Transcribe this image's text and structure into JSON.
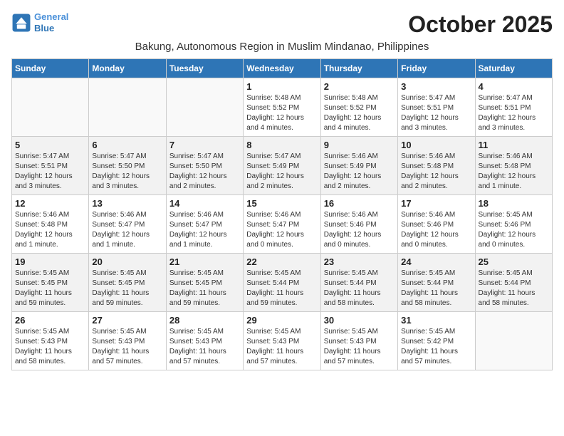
{
  "logo": {
    "line1": "General",
    "line2": "Blue"
  },
  "title": "October 2025",
  "subtitle": "Bakung, Autonomous Region in Muslim Mindanao, Philippines",
  "days_of_week": [
    "Sunday",
    "Monday",
    "Tuesday",
    "Wednesday",
    "Thursday",
    "Friday",
    "Saturday"
  ],
  "weeks": [
    [
      {
        "day": "",
        "info": ""
      },
      {
        "day": "",
        "info": ""
      },
      {
        "day": "",
        "info": ""
      },
      {
        "day": "1",
        "info": "Sunrise: 5:48 AM\nSunset: 5:52 PM\nDaylight: 12 hours\nand 4 minutes."
      },
      {
        "day": "2",
        "info": "Sunrise: 5:48 AM\nSunset: 5:52 PM\nDaylight: 12 hours\nand 4 minutes."
      },
      {
        "day": "3",
        "info": "Sunrise: 5:47 AM\nSunset: 5:51 PM\nDaylight: 12 hours\nand 3 minutes."
      },
      {
        "day": "4",
        "info": "Sunrise: 5:47 AM\nSunset: 5:51 PM\nDaylight: 12 hours\nand 3 minutes."
      }
    ],
    [
      {
        "day": "5",
        "info": "Sunrise: 5:47 AM\nSunset: 5:51 PM\nDaylight: 12 hours\nand 3 minutes."
      },
      {
        "day": "6",
        "info": "Sunrise: 5:47 AM\nSunset: 5:50 PM\nDaylight: 12 hours\nand 3 minutes."
      },
      {
        "day": "7",
        "info": "Sunrise: 5:47 AM\nSunset: 5:50 PM\nDaylight: 12 hours\nand 2 minutes."
      },
      {
        "day": "8",
        "info": "Sunrise: 5:47 AM\nSunset: 5:49 PM\nDaylight: 12 hours\nand 2 minutes."
      },
      {
        "day": "9",
        "info": "Sunrise: 5:46 AM\nSunset: 5:49 PM\nDaylight: 12 hours\nand 2 minutes."
      },
      {
        "day": "10",
        "info": "Sunrise: 5:46 AM\nSunset: 5:48 PM\nDaylight: 12 hours\nand 2 minutes."
      },
      {
        "day": "11",
        "info": "Sunrise: 5:46 AM\nSunset: 5:48 PM\nDaylight: 12 hours\nand 1 minute."
      }
    ],
    [
      {
        "day": "12",
        "info": "Sunrise: 5:46 AM\nSunset: 5:48 PM\nDaylight: 12 hours\nand 1 minute."
      },
      {
        "day": "13",
        "info": "Sunrise: 5:46 AM\nSunset: 5:47 PM\nDaylight: 12 hours\nand 1 minute."
      },
      {
        "day": "14",
        "info": "Sunrise: 5:46 AM\nSunset: 5:47 PM\nDaylight: 12 hours\nand 1 minute."
      },
      {
        "day": "15",
        "info": "Sunrise: 5:46 AM\nSunset: 5:47 PM\nDaylight: 12 hours\nand 0 minutes."
      },
      {
        "day": "16",
        "info": "Sunrise: 5:46 AM\nSunset: 5:46 PM\nDaylight: 12 hours\nand 0 minutes."
      },
      {
        "day": "17",
        "info": "Sunrise: 5:46 AM\nSunset: 5:46 PM\nDaylight: 12 hours\nand 0 minutes."
      },
      {
        "day": "18",
        "info": "Sunrise: 5:45 AM\nSunset: 5:46 PM\nDaylight: 12 hours\nand 0 minutes."
      }
    ],
    [
      {
        "day": "19",
        "info": "Sunrise: 5:45 AM\nSunset: 5:45 PM\nDaylight: 11 hours\nand 59 minutes."
      },
      {
        "day": "20",
        "info": "Sunrise: 5:45 AM\nSunset: 5:45 PM\nDaylight: 11 hours\nand 59 minutes."
      },
      {
        "day": "21",
        "info": "Sunrise: 5:45 AM\nSunset: 5:45 PM\nDaylight: 11 hours\nand 59 minutes."
      },
      {
        "day": "22",
        "info": "Sunrise: 5:45 AM\nSunset: 5:44 PM\nDaylight: 11 hours\nand 59 minutes."
      },
      {
        "day": "23",
        "info": "Sunrise: 5:45 AM\nSunset: 5:44 PM\nDaylight: 11 hours\nand 58 minutes."
      },
      {
        "day": "24",
        "info": "Sunrise: 5:45 AM\nSunset: 5:44 PM\nDaylight: 11 hours\nand 58 minutes."
      },
      {
        "day": "25",
        "info": "Sunrise: 5:45 AM\nSunset: 5:44 PM\nDaylight: 11 hours\nand 58 minutes."
      }
    ],
    [
      {
        "day": "26",
        "info": "Sunrise: 5:45 AM\nSunset: 5:43 PM\nDaylight: 11 hours\nand 58 minutes."
      },
      {
        "day": "27",
        "info": "Sunrise: 5:45 AM\nSunset: 5:43 PM\nDaylight: 11 hours\nand 57 minutes."
      },
      {
        "day": "28",
        "info": "Sunrise: 5:45 AM\nSunset: 5:43 PM\nDaylight: 11 hours\nand 57 minutes."
      },
      {
        "day": "29",
        "info": "Sunrise: 5:45 AM\nSunset: 5:43 PM\nDaylight: 11 hours\nand 57 minutes."
      },
      {
        "day": "30",
        "info": "Sunrise: 5:45 AM\nSunset: 5:43 PM\nDaylight: 11 hours\nand 57 minutes."
      },
      {
        "day": "31",
        "info": "Sunrise: 5:45 AM\nSunset: 5:42 PM\nDaylight: 11 hours\nand 57 minutes."
      },
      {
        "day": "",
        "info": ""
      }
    ]
  ]
}
